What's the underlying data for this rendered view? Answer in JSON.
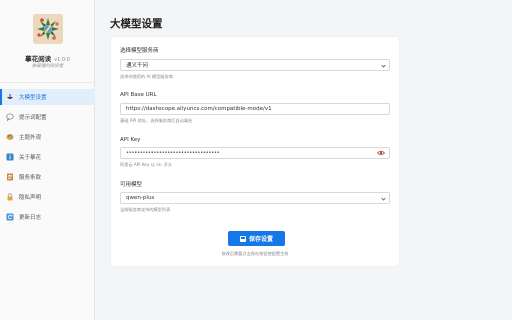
{
  "app": {
    "name": "摹花阅读",
    "version": "v1.0.0",
    "tagline": "做最懂的阅读者"
  },
  "sidebar": {
    "items": [
      {
        "label": "大模型设置",
        "icon": "bowl-icon",
        "active": true
      },
      {
        "label": "提示词配置",
        "icon": "speech-bubble-icon",
        "active": false
      },
      {
        "label": "主题外观",
        "icon": "palette-icon",
        "active": false
      },
      {
        "label": "关于摹花",
        "icon": "info-icon",
        "active": false
      },
      {
        "label": "服务条款",
        "icon": "document-icon",
        "active": false
      },
      {
        "label": "隐私声明",
        "icon": "lock-icon",
        "active": false
      },
      {
        "label": "更新日志",
        "icon": "refresh-icon",
        "active": false
      }
    ]
  },
  "page": {
    "title": "大模型设置"
  },
  "form": {
    "provider": {
      "label": "选择模型服务商",
      "value": "通义千问",
      "hint": "选择你使用的 AI 模型服务商"
    },
    "base_url": {
      "label": "API Base URL",
      "value": "https://dashscope.aliyuncs.com/compatible-mode/v1",
      "hint": "基础 API 地址，选择服务商后自动填充"
    },
    "api_key": {
      "label": "API Key",
      "value": "••••••••••••••••••••••••••••••••••",
      "hint": "阿里云 API Key 以 sk- 开头"
    },
    "model": {
      "label": "可用模型",
      "value": "qwen-plus",
      "hint": "当前服务商支持的模型列表"
    }
  },
  "actions": {
    "save_label": "保存设置",
    "save_note": "修改后需要点击保存按钮使配置生效"
  },
  "colors": {
    "accent": "#1677e8",
    "active_bg": "#e3eefb"
  }
}
